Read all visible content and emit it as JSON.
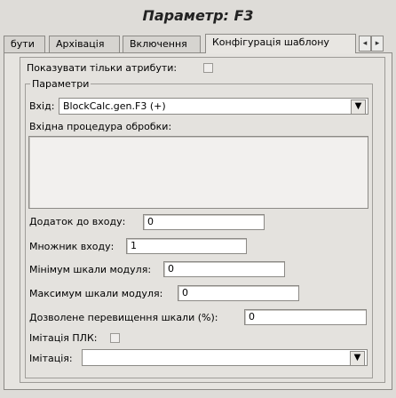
{
  "window": {
    "title": "Параметр: F3"
  },
  "tabs": [
    {
      "label": "бути"
    },
    {
      "label": "Архівація"
    },
    {
      "label": "Включення"
    },
    {
      "label": "Конфігурація шаблону",
      "active": true
    }
  ],
  "tab_scroll": {
    "left_glyph": "◂",
    "right_glyph": "▸"
  },
  "attrs_only": {
    "label": "Показувати тільки атрибути:",
    "checked": false
  },
  "params_group": {
    "title": "Параметри",
    "input": {
      "label": "Вхід:",
      "value": "BlockCalc.gen.F3 (+)"
    },
    "proc": {
      "label": "Вхідна процедура обробки:",
      "value": ""
    },
    "offset": {
      "label": "Додаток до входу:",
      "value": "0"
    },
    "multiplier": {
      "label": "Множник входу:",
      "value": "1"
    },
    "scale_min": {
      "label": "Мінімум шкали модуля:",
      "value": "0"
    },
    "scale_max": {
      "label": "Максимум шкали модуля:",
      "value": "0"
    },
    "overrun": {
      "label": "Дозволене перевищення шкали (%):",
      "value": "0"
    },
    "plc_sim": {
      "label": "Імітація ПЛК:",
      "checked": false
    },
    "sim": {
      "label": "Імітація:",
      "value": ""
    }
  },
  "icons": {
    "dropdown": "chevron-down-icon",
    "scroll_left": "arrow-left-icon",
    "scroll_right": "arrow-right-icon"
  }
}
